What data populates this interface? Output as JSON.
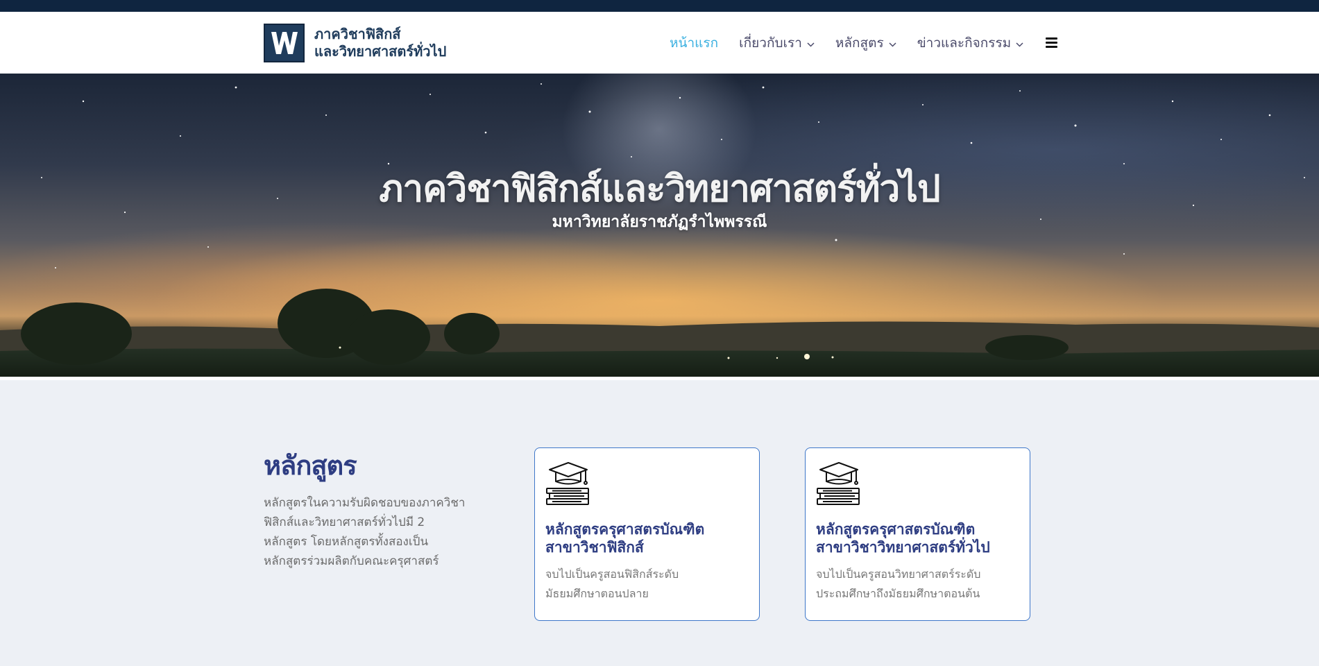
{
  "colors": {
    "topbar": "#0f2540",
    "brand": "#1f3c5c",
    "nav_active": "#3ab0e0",
    "nav_text": "#4a4a6a",
    "heading": "#2e3d82",
    "card_border": "#3e77c9",
    "section_bg": "#edf0f5"
  },
  "header": {
    "logo_line1": "ภาควิชาฟิสิกส์",
    "logo_line2": "และวิทยาศาสตร์ทั่วไป",
    "logo_icon": "w-logo-icon",
    "nav": [
      {
        "label": "หน้าแรก",
        "active": true,
        "has_dropdown": false
      },
      {
        "label": "เกี่ยวกับเรา",
        "active": false,
        "has_dropdown": true
      },
      {
        "label": "หลักสูตร",
        "active": false,
        "has_dropdown": true
      },
      {
        "label": "ข่าวและกิจกรรม",
        "active": false,
        "has_dropdown": true
      }
    ],
    "menu_icon": "hamburger-menu-icon"
  },
  "hero": {
    "title": "ภาควิชาฟิสิกส์และวิทยาศาสตร์ทั่วไป",
    "subtitle": "มหาวิทยาลัยราชภัฏรำไพพรรณี",
    "background": "night-sky-milky-way-landscape"
  },
  "courses": {
    "heading": "หลักสูตร",
    "description_lines": [
      "หลักสูตรในความรับผิดชอบของภาควิชา",
      "ฟิสิกส์และวิทยาศาสตร์ทั่วไปมี 2",
      "หลักสูตร โดยหลักสูตรทั้งสองเป็น",
      "หลักสูตรร่วมผลิตกับคณะครุศาสตร์"
    ],
    "cards": [
      {
        "icon": "graduation-cap-books-icon",
        "title_line1": "หลักสูตรครุศาสตรบัณฑิต",
        "title_line2": "สาขาวิชาฟิสิกส์",
        "desc_line1": "จบไปเป็นครูสอนฟิสิกส์ระดับ",
        "desc_line2": "มัธยมศึกษาตอนปลาย"
      },
      {
        "icon": "graduation-cap-books-icon",
        "title_line1": "หลักสูตรครุศาสตรบัณฑิต",
        "title_line2": "สาขาวิชาวิทยาศาสตร์ทั่วไป",
        "desc_line1": "จบไปเป็นครูสอนวิทยาศาสตร์ระดับ",
        "desc_line2": "ประถมศึกษาถึงมัธยมศึกษาตอนต้น"
      }
    ]
  }
}
